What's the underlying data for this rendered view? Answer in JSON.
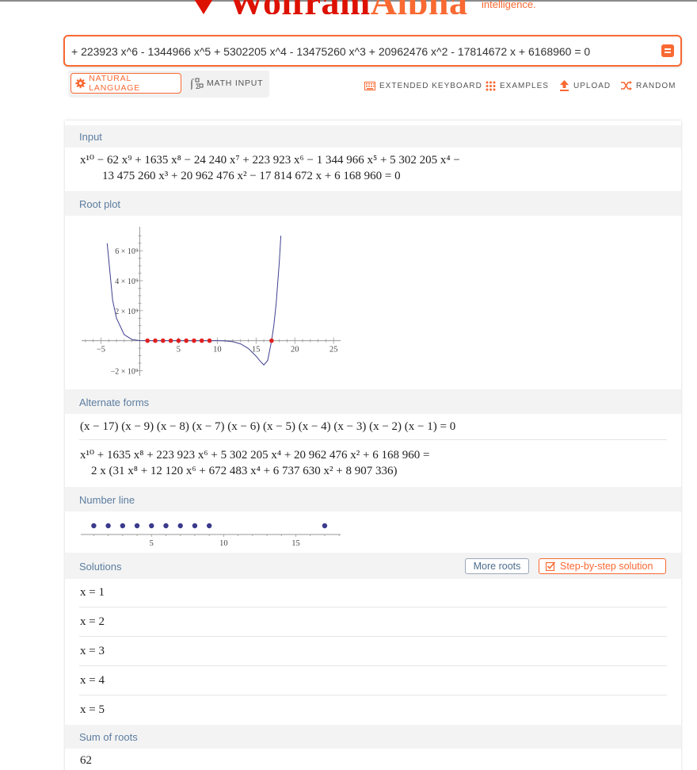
{
  "logo": {
    "word_main": "Wolfram",
    "word_alpha": "Alpha",
    "subtitle": "intelligence."
  },
  "search": {
    "value": "+ 223923 x^6 - 1344966 x^5 + 5302205 x^4 - 13475260 x^3 + 20962476 x^2 - 17814672 x + 6168960 = 0"
  },
  "modes": {
    "natural_language": "NATURAL LANGUAGE",
    "math_input": "MATH INPUT"
  },
  "toolbar": {
    "extended_keyboard": "EXTENDED KEYBOARD",
    "examples": "EXAMPLES",
    "upload": "UPLOAD",
    "random": "RANDOM"
  },
  "pods": {
    "input": {
      "title": "Input",
      "line1": "x¹⁰ − 62 x⁹ + 1635 x⁸ − 24 240 x⁷ + 223 923 x⁶ − 1 344 966 x⁵ + 5 302 205 x⁴ −",
      "line2": "13 475 260 x³ + 20 962 476 x² − 17 814 672 x + 6 168 960 = 0"
    },
    "root_plot": {
      "title": "Root plot"
    },
    "alternate_forms": {
      "title": "Alternate forms",
      "form1": "(x − 17) (x − 9) (x − 8) (x − 7) (x − 6) (x − 5) (x − 4) (x − 3) (x − 2) (x − 1) = 0",
      "form2_line1": "x¹⁰ + 1635 x⁸ + 223 923 x⁶ + 5 302 205 x⁴ + 20 962 476 x² + 6 168 960 =",
      "form2_line2": "2 x (31 x⁸ + 12 120 x⁶ + 672 483 x⁴ + 6 737 630 x² + 8 907 336)"
    },
    "number_line": {
      "title": "Number line"
    },
    "solutions": {
      "title": "Solutions",
      "more_roots": "More roots",
      "step_by_step": "Step-by-step solution",
      "items": [
        "x = 1",
        "x = 2",
        "x = 3",
        "x = 4",
        "x = 5"
      ]
    },
    "sum_of_roots": {
      "title": "Sum of roots",
      "value": "62"
    }
  },
  "chart_data": [
    {
      "type": "line",
      "title": "Root plot",
      "xlim": [
        -7,
        26
      ],
      "ylim": [
        -2000000000,
        6000000000
      ],
      "x_ticks": [
        "-5",
        "5",
        "10",
        "15",
        "20",
        "25"
      ],
      "y_ticks": [
        "6 × 10⁹",
        "4 × 10⁹",
        "2 × 10⁹",
        "-2 × 10⁹"
      ],
      "series": [
        {
          "x": [
            -4.2,
            -3.5,
            -3,
            -2,
            -1,
            0,
            1,
            5,
            9,
            10,
            11,
            12,
            13,
            14,
            15,
            15.5,
            16,
            16.5,
            17,
            17.3,
            17.6,
            18,
            18.2
          ],
          "values": [
            6500000000,
            2700000000,
            1500000000,
            400000000,
            80000000,
            6168960,
            0,
            0,
            0,
            -1500000,
            -15000000,
            -70000000,
            -210000000,
            -520000000,
            -1030000000,
            -1350000000,
            -1620000000,
            -1320000000,
            0,
            1050000000,
            2500000000,
            5300000000,
            7000000000
          ]
        }
      ],
      "roots": [
        1,
        2,
        3,
        4,
        5,
        6,
        7,
        8,
        9,
        17
      ],
      "colors": {
        "curve": "#3f3f8f",
        "root": "#e02020"
      }
    },
    {
      "type": "scatter",
      "title": "Number line",
      "xlim": [
        0,
        18
      ],
      "x_ticks": [
        "5",
        "10",
        "15"
      ],
      "points": [
        1,
        2,
        3,
        4,
        5,
        6,
        7,
        8,
        9,
        17
      ],
      "colors": {
        "point": "#3a3a8c"
      }
    }
  ],
  "colors": {
    "accent": "#f96932",
    "logo_red": "#dd1100",
    "pod_title": "#5c7da0"
  }
}
